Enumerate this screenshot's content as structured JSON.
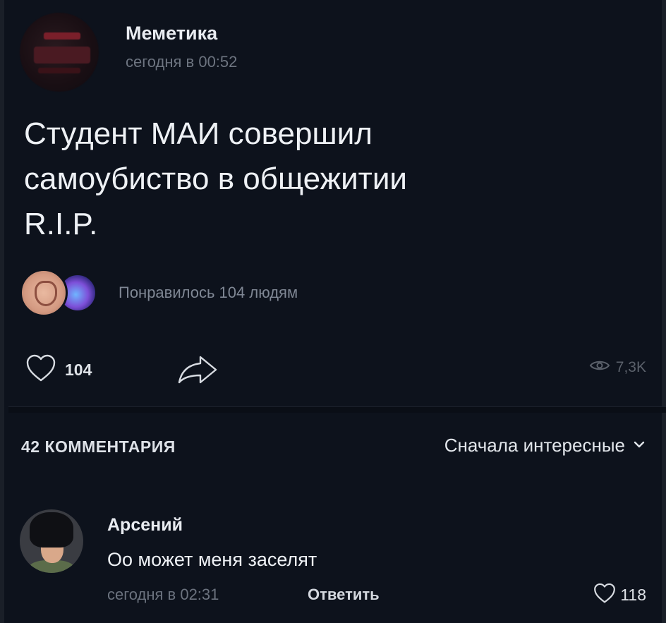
{
  "post": {
    "group_name": "Меметика",
    "time": "сегодня в 00:52",
    "text_line_1": "Студент МАИ совершил",
    "text_line_2": "самоубиство в общежитии",
    "text_line_3": "R.I.P.",
    "likes_summary": "Понравилось 104 людям",
    "like_count": "104",
    "views": "7,3K",
    "icons": {
      "like": "heart-icon",
      "share": "share-arrow-icon",
      "views": "eye-icon"
    }
  },
  "comments_section": {
    "count_label": "42 КОММЕНТАРИЯ",
    "sort_label": "Сначала интересные",
    "sort_icon": "chevron-down-icon"
  },
  "comments": [
    {
      "author": "Арсений",
      "text": "Оо может меня заселят",
      "time": "сегодня в 02:31",
      "reply_label": "Ответить",
      "likes": "118"
    }
  ],
  "colors": {
    "background": "#0d121c",
    "primary_text": "#eef1f5",
    "secondary_text": "#6d7480"
  }
}
